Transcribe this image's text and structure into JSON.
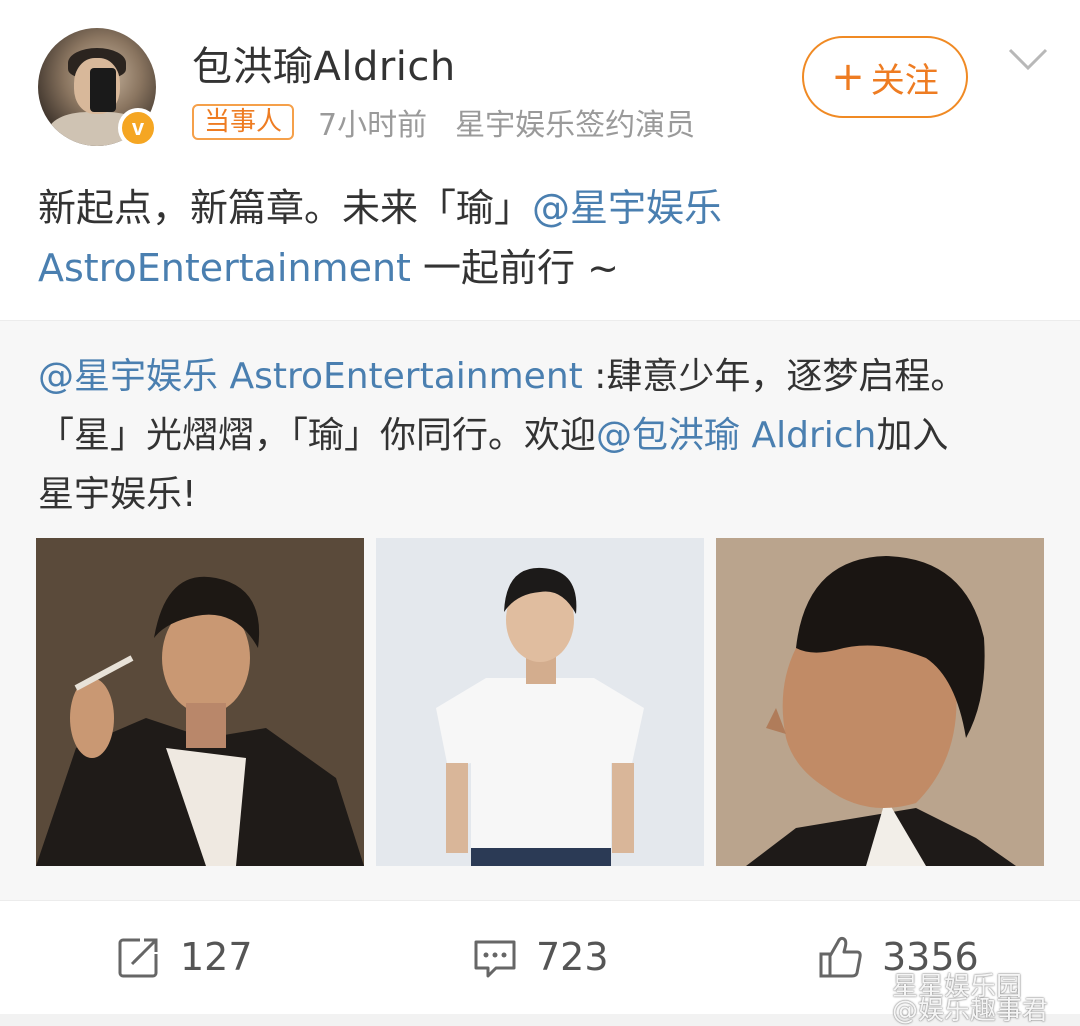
{
  "post": {
    "author": "包洪瑜Aldrich",
    "verified_badge": "v",
    "tag": "当事人",
    "time": "7小时前",
    "source": "星宇娱乐签约演员",
    "follow_plus": "+",
    "follow_label": "关注",
    "text_plain_1": "新起点，新篇章。未来「瑜」",
    "text_mention_1": "@星宇娱乐",
    "text_mention_2": "AstroEntertainment",
    "text_plain_2": " 一起前行 ~"
  },
  "repost": {
    "mention": "@星宇娱乐 AstroEntertainment",
    "line1_rest": " :肆意少年，逐梦启程。",
    "line2_plain": "「星」光熠熠，「瑜」你同行。欢迎",
    "line2_mention": "@包洪瑜 Aldrich",
    "line2_rest": "加入",
    "line3": "星宇娱乐!"
  },
  "actions": {
    "repost_count": "127",
    "comment_count": "723",
    "like_count": "3356"
  },
  "watermark": {
    "line1": "星星娱乐园",
    "line2": "@娱乐趣事君"
  },
  "colors": {
    "accent": "#ee7c22",
    "mention": "#4a7fb0",
    "muted": "#9a9a9a",
    "repost_bg": "#f7f7f7"
  },
  "icons": [
    "chevron-down-icon",
    "repost-icon",
    "comment-icon",
    "like-icon",
    "verified-icon"
  ]
}
